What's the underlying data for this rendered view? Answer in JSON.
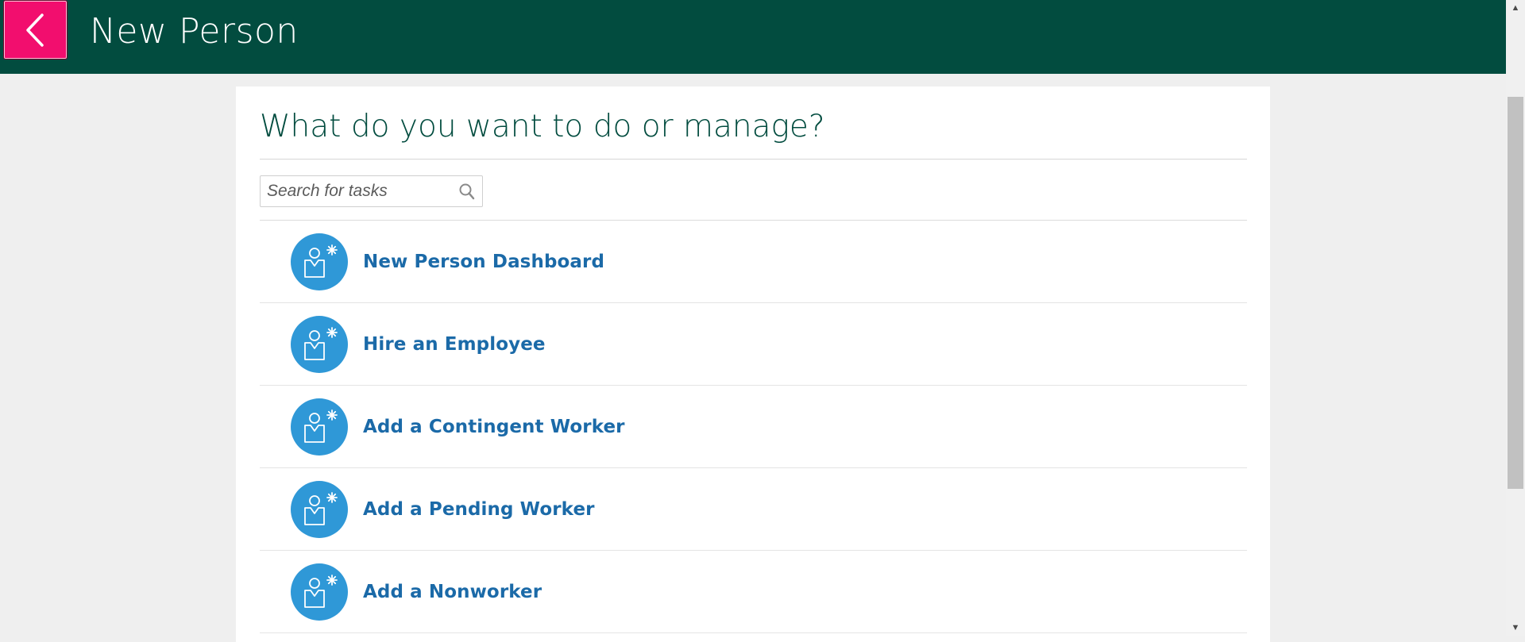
{
  "header": {
    "title": "New Person",
    "back_icon": "chevron-left-icon",
    "background_color": "#024c3f",
    "back_button_color": "#f20e6e"
  },
  "main": {
    "question": "What do you want to do or manage?",
    "search": {
      "placeholder": "Search for tasks",
      "value": "",
      "icon": "search-icon"
    },
    "tasks": [
      {
        "label": "New Person Dashboard",
        "icon": "new-person-icon"
      },
      {
        "label": "Hire an Employee",
        "icon": "new-person-icon"
      },
      {
        "label": "Add a Contingent Worker",
        "icon": "new-person-icon"
      },
      {
        "label": "Add a Pending Worker",
        "icon": "new-person-icon"
      },
      {
        "label": "Add a Nonworker",
        "icon": "new-person-icon"
      }
    ],
    "task_icon_color": "#2f98d7",
    "task_label_color": "#1b6aa8"
  }
}
